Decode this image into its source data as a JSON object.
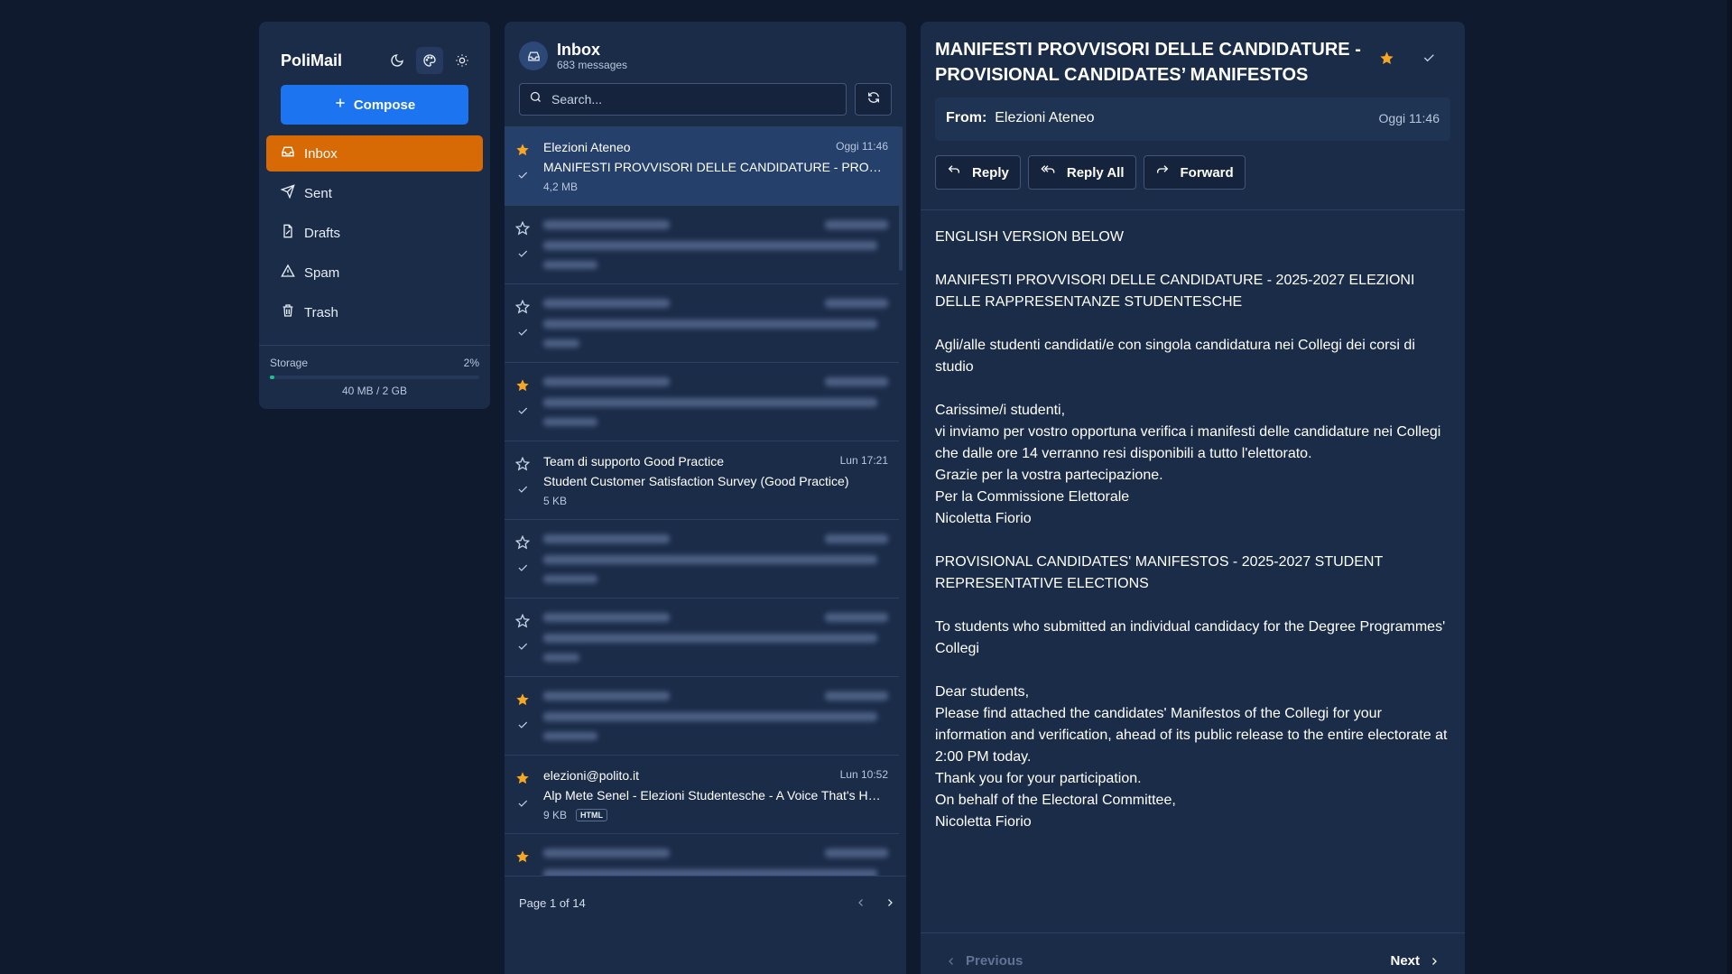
{
  "app": {
    "name": "PoliMail"
  },
  "sidebar": {
    "theme_icons": [
      "moon-icon",
      "palette-icon",
      "sun-icon"
    ],
    "compose_label": "Compose",
    "items": [
      {
        "label": "Inbox",
        "icon": "inbox-icon",
        "active": true
      },
      {
        "label": "Sent",
        "icon": "send-icon",
        "active": false
      },
      {
        "label": "Drafts",
        "icon": "drafts-icon",
        "active": false
      },
      {
        "label": "Spam",
        "icon": "warning-icon",
        "active": false
      },
      {
        "label": "Trash",
        "icon": "trash-icon",
        "active": false
      }
    ],
    "storage": {
      "label": "Storage",
      "percent": "2%",
      "fill_fraction": 0.02,
      "usage": "40 MB / 2 GB",
      "color": "#1fc28e"
    }
  },
  "list": {
    "title": "Inbox",
    "count": "683 messages",
    "search_placeholder": "Search...",
    "messages": [
      {
        "sender": "Elezioni Ateneo",
        "time": "Oggi 11:46",
        "subject": "MANIFESTI PROVVISORI DELLE CANDIDATURE - PROVISIONAL CANDIDATES’ MANIFESTOS",
        "size": "4,2 MB",
        "starred": true,
        "selected": true
      },
      {
        "sender": "",
        "time": "",
        "subject": "",
        "size": "",
        "starred": false,
        "redacted": true
      },
      {
        "sender": "",
        "time": "",
        "subject": "",
        "size": "",
        "starred": false,
        "redacted": true
      },
      {
        "sender": "",
        "time": "",
        "subject": "",
        "size": "",
        "starred": true,
        "redacted": true
      },
      {
        "sender": "Team di supporto Good Practice",
        "time": "Lun 17:21",
        "subject": "Student Customer Satisfaction Survey (Good Practice)",
        "size": "5 KB",
        "starred": false
      },
      {
        "sender": "",
        "time": "",
        "subject": "",
        "size": "",
        "starred": false,
        "redacted": true
      },
      {
        "sender": "",
        "time": "",
        "subject": "",
        "size": "",
        "starred": false,
        "redacted": true
      },
      {
        "sender": "",
        "time": "",
        "subject": "",
        "size": "",
        "starred": true,
        "redacted": true
      },
      {
        "sender": "elezioni@polito.it",
        "time": "Lun 10:52",
        "subject": "Alp Mete Senel - Elezioni Studentesche - A Voice That's Heard",
        "size": "9 KB",
        "tag": "HTML",
        "starred": true
      },
      {
        "sender": "",
        "time": "",
        "subject": "",
        "size": "",
        "starred": true,
        "redacted": true
      }
    ],
    "pagination": "Page 1 of 14"
  },
  "reader": {
    "title": "MANIFESTI PROVVISORI DELLE CANDIDATURE - PROVISIONAL CANDIDATES’ MANIFESTOS",
    "from_label": "From:",
    "from": "Elezioni Ateneo",
    "time": "Oggi 11:46",
    "actions": {
      "reply": "Reply",
      "reply_all": "Reply All",
      "forward": "Forward"
    },
    "body": [
      [
        "ENGLISH VERSION BELOW"
      ],
      [
        "MANIFESTI PROVVISORI DELLE CANDIDATURE - 2025-2027 ELEZIONI DELLE RAPPRESENTANZE STUDENTESCHE"
      ],
      [
        "Agli/alle studenti candidati/e con singola candidatura nei Collegi dei corsi di studio"
      ],
      [
        "Carissime/i studenti,",
        "vi inviamo per vostro opportuna verifica i manifesti delle candidature nei Collegi che dalle ore 14 verranno resi disponibili a tutto l'elettorato.",
        "Grazie per la vostra partecipazione.",
        "Per la Commissione Elettorale",
        "Nicoletta Fiorio"
      ],
      [
        ""
      ],
      [
        "PROVISIONAL CANDIDATES' MANIFESTOS - 2025-2027 STUDENT REPRESENTATIVE ELECTIONS"
      ],
      [
        "To students who submitted an individual candidacy for the Degree Programmes' Collegi"
      ],
      [
        "Dear students,",
        "Please find attached the candidates' Manifestos of the Collegi for your information and verification, ahead of its public release to the entire electorate at 2:00 PM today.",
        "Thank you for your participation.",
        "On behalf of the Electoral Committee,",
        "Nicoletta Fiorio"
      ]
    ],
    "prev_label": "Previous",
    "next_label": "Next"
  },
  "colors": {
    "accent": "#1c74f0",
    "active_nav": "#d86a06",
    "star": "#f5a623"
  }
}
